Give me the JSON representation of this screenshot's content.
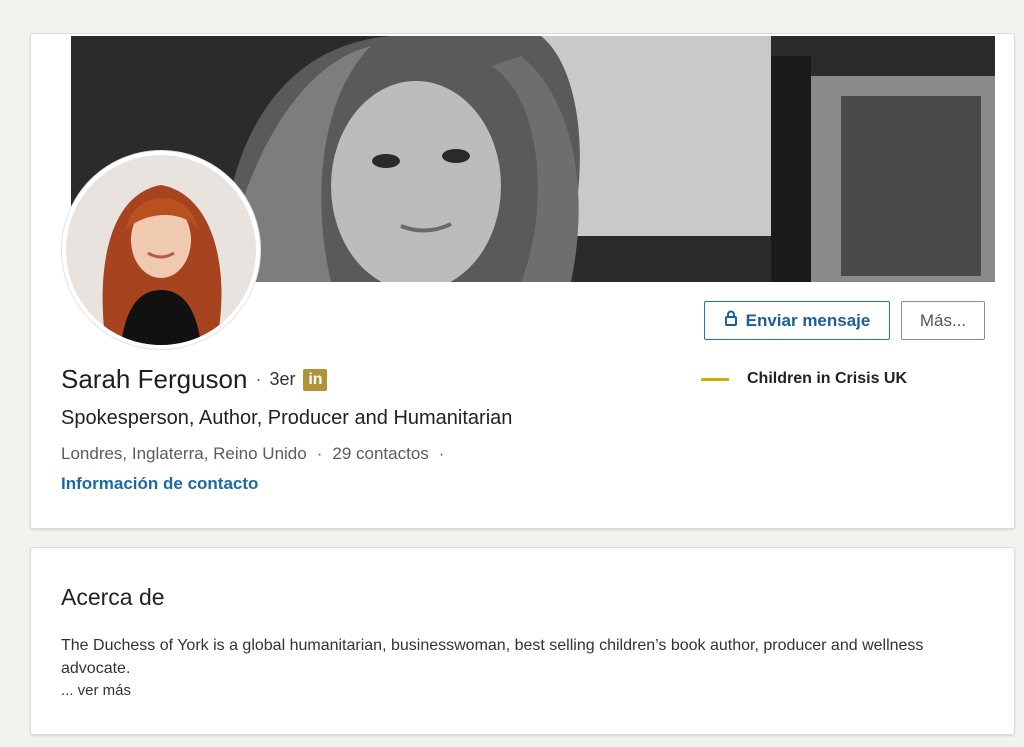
{
  "profile": {
    "name": "Sarah Ferguson",
    "separator": "·",
    "degree": "3er",
    "linkedin_badge": "in",
    "headline": "Spokesperson, Author, Producer and Humanitarian",
    "location": "Londres, Inglaterra, Reino Unido",
    "meta_separator": "·",
    "connections": "29 contactos",
    "trailing_separator": "·",
    "contact_info_link": "Información de contacto",
    "company": "Children in Crisis UK",
    "company_accent_color": "#c8b400"
  },
  "actions": {
    "message_label": "Enviar mensaje",
    "message_icon": "lock-icon",
    "more_label": "Más..."
  },
  "about": {
    "title": "Acerca de",
    "text": "The Duchess of York is a global humanitarian, businesswoman, best selling children’s book author, producer and wellness advocate.",
    "see_more": "... ver más"
  },
  "colors": {
    "link_blue": "#1c6aa5",
    "badge_gold": "#b09339"
  }
}
